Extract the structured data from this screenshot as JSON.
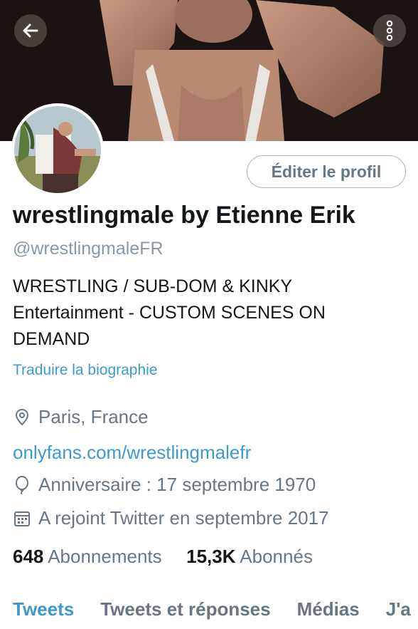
{
  "header": {
    "back_icon": "arrow-left-icon",
    "more_icon": "vertical-dots-icon"
  },
  "profile": {
    "edit_label": "Éditer le profil",
    "name": "wrestlingmale by Etienne Erik",
    "handle": "@wrestlingmaleFR",
    "bio_lines": [
      "WRESTLING / SUB-DOM & KINKY",
      "Entertainment - CUSTOM SCENES ON",
      "DEMAND"
    ],
    "translate_label": "Traduire la biographie",
    "location": "Paris, France",
    "website": "onlyfans.com/wrestlingmalefr",
    "birthday": "Anniversaire : 17 septembre 1970",
    "joined": "A rejoint Twitter en septembre 2017"
  },
  "stats": {
    "following_count": "648",
    "following_label": "Abonnements",
    "followers_count": "15,3K",
    "followers_label": "Abonnés"
  },
  "tabs": [
    {
      "label": "Tweets",
      "active": true
    },
    {
      "label": "Tweets et réponses",
      "active": false
    },
    {
      "label": "Médias",
      "active": false
    },
    {
      "label": "J'a",
      "active": false
    }
  ],
  "colors": {
    "accent": "#3d9ad1",
    "secondary_text": "#657786",
    "border": "#aab8c2"
  }
}
